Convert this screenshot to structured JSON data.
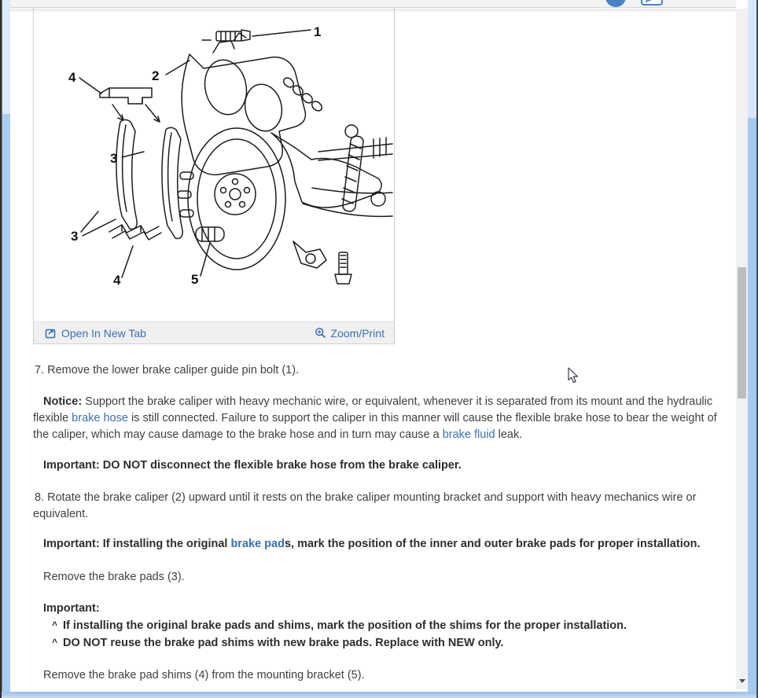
{
  "window": {
    "header": {
      "icons": [
        {
          "name": "profile-icon",
          "shape": "filled-circle",
          "color": "#4a80c4"
        },
        {
          "name": "print-icon",
          "shape": "printer-outline",
          "color": "#4a80c4"
        }
      ]
    }
  },
  "figure": {
    "description": "Exploded line drawing of front brake caliper, pads, shims and mounting bracket",
    "callouts": [
      "1",
      "2",
      "4",
      "3",
      "3",
      "4",
      "5"
    ],
    "toolbar": {
      "open_label": "Open In New Tab",
      "zoom_label": "Zoom/Print"
    }
  },
  "content": {
    "step7": "7. Remove the lower brake caliper guide pin bolt (1).",
    "notice": {
      "label": "Notice:",
      "before": " Support the brake caliper with heavy mechanic wire, or equivalent, whenever it is separated from its mount and the hydraulic flexible ",
      "link1": "brake hose",
      "middle": " is still connected. Failure to support the caliper in this manner will cause the flexible brake hose to bear the weight of the caliper, which may cause damage to the brake hose and in turn may cause a ",
      "link2": "brake fluid",
      "after": " leak."
    },
    "important1": {
      "label": "Important:",
      "text": " DO NOT disconnect the flexible brake hose from the brake caliper."
    },
    "step8": "8. Rotate the brake caliper (2) upward until it rests on the brake caliper mounting bracket and support with heavy mechanics wire or equivalent.",
    "important2": {
      "label": "Important:",
      "before": " If installing the original ",
      "link": "brake pad",
      "after": "s, mark the position of the inner and outer brake pads for proper installation."
    },
    "remove_pads": "Remove the brake pads (3).",
    "important3": {
      "label": "Important:",
      "bullet_glyph": "^",
      "bullets": [
        "If installing the original brake pads and shims, mark the position of the shims for the proper installation.",
        "DO NOT reuse the brake pad shims with new brake pads. Replace with NEW only."
      ]
    },
    "remove_shims": "Remove the brake pad shims (4) from the mounting bracket (5)."
  },
  "colors": {
    "link_blue": "#3a6fb5",
    "body_text": "#3f3f3f",
    "bold_text": "#2d2d2d",
    "toolbar_bg": "#f0f0f1",
    "card_border": "#cfcfcf",
    "scroll_thumb": "#bdbdbd",
    "scroll_track": "#f1f1f1",
    "window_border_blue_light": "#dcebfa",
    "window_border_blue": "#a8cdf0",
    "header_icon_blue": "#4a80c4"
  }
}
